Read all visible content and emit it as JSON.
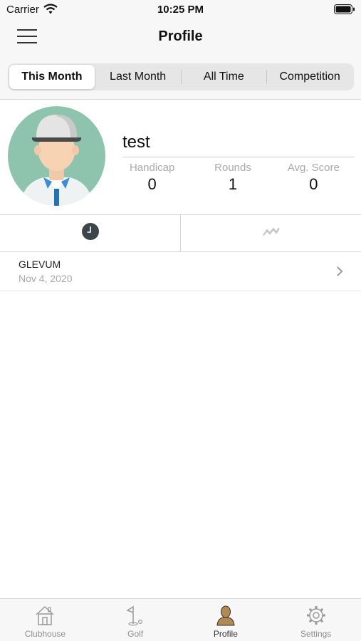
{
  "status_bar": {
    "carrier": "Carrier",
    "time": "10:25 PM"
  },
  "nav": {
    "title": "Profile",
    "menu_icon": "hamburger-menu-icon"
  },
  "segments": {
    "items": [
      "This Month",
      "Last Month",
      "All Time",
      "Competition"
    ],
    "selected": "This Month"
  },
  "profile": {
    "username": "test",
    "stats": [
      {
        "label": "Handicap",
        "value": "0"
      },
      {
        "label": "Rounds",
        "value": "1"
      },
      {
        "label": "Avg. Score",
        "value": "0"
      }
    ]
  },
  "view_tabs": {
    "items": [
      "clock-icon",
      "trend-line-icon"
    ],
    "selected": "clock-icon"
  },
  "rounds": [
    {
      "course": "GLEVUM",
      "date": "Nov 4, 2020"
    }
  ],
  "tab_bar": {
    "items": [
      {
        "label": "Clubhouse",
        "icon": "clubhouse-icon"
      },
      {
        "label": "Golf",
        "icon": "golf-flag-icon"
      },
      {
        "label": "Profile",
        "icon": "profile-icon"
      },
      {
        "label": "Settings",
        "icon": "settings-gear-icon"
      }
    ],
    "selected": "Profile"
  },
  "colors": {
    "avatar_bg": "#8ec3ad",
    "active_tab_icon": "#b08a55",
    "clock_fill": "#3c4547"
  }
}
